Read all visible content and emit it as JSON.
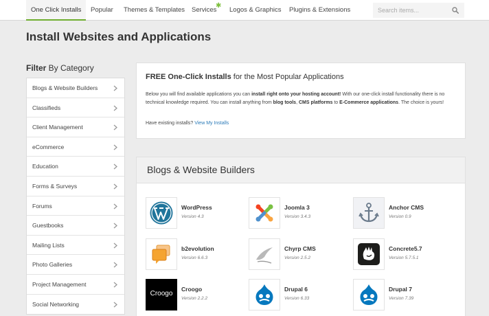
{
  "nav": {
    "items": [
      "One Click Installs",
      "Popular",
      "Themes & Templates",
      "Services",
      "Logos & Graphics",
      "Plugins & Extensions"
    ],
    "active_index": 0,
    "search_placeholder": "Search items...",
    "accent_color": "#6fae2f"
  },
  "page_title": "Install Websites and Applications",
  "filter": {
    "heading_bold": "Filter",
    "heading_rest": " By Category",
    "categories": [
      "Blogs & Website Builders",
      "Classifieds",
      "Client Management",
      "eCommerce",
      "Education",
      "Forms & Surveys",
      "Forums",
      "Guestbooks",
      "Mailing Lists",
      "Photo Galleries",
      "Project Management",
      "Social Networking"
    ]
  },
  "intro": {
    "title_bold": "FREE One-Click Installs",
    "title_rest": " for the Most Popular Applications",
    "text_1": "Below you will find available applications you can ",
    "text_bold_1": "install right onto your hosting account!",
    "text_2": " With our one-click install functionality there is no technical knowledge required. You can install anything from ",
    "text_bold_2": "blog tools",
    "text_3": ", ",
    "text_bold_3": "CMS platforms",
    "text_4": " to ",
    "text_bold_4": "E-Commerce applications",
    "text_5": ". The choice is yours!",
    "existing_text": "Have existing installs? ",
    "existing_link": "View My Installs"
  },
  "category_section": {
    "title": "Blogs & Website Builders",
    "apps": [
      {
        "name": "WordPress",
        "version": "Version 4.3",
        "icon": "wordpress-logo"
      },
      {
        "name": "Joomla 3",
        "version": "Version 3.4.3",
        "icon": "joomla-logo"
      },
      {
        "name": "Anchor CMS",
        "version": "Version 0.9",
        "icon": "anchor-logo"
      },
      {
        "name": "b2evolution",
        "version": "Version 6.6.3",
        "icon": "b2evolution-logo"
      },
      {
        "name": "Chyrp CMS",
        "version": "Version 2.5.2",
        "icon": "chyrp-logo"
      },
      {
        "name": "Concrete5.7",
        "version": "Version 5.7.5.1",
        "icon": "concrete5-logo"
      },
      {
        "name": "Croogo",
        "version": "Version 2.2.2",
        "icon": "croogo-logo",
        "logo_text": "Croogo"
      },
      {
        "name": "Drupal 6",
        "version": "Version 6.33",
        "icon": "drupal-logo"
      },
      {
        "name": "Drupal 7",
        "version": "Version 7.39",
        "icon": "drupal-logo"
      }
    ]
  }
}
